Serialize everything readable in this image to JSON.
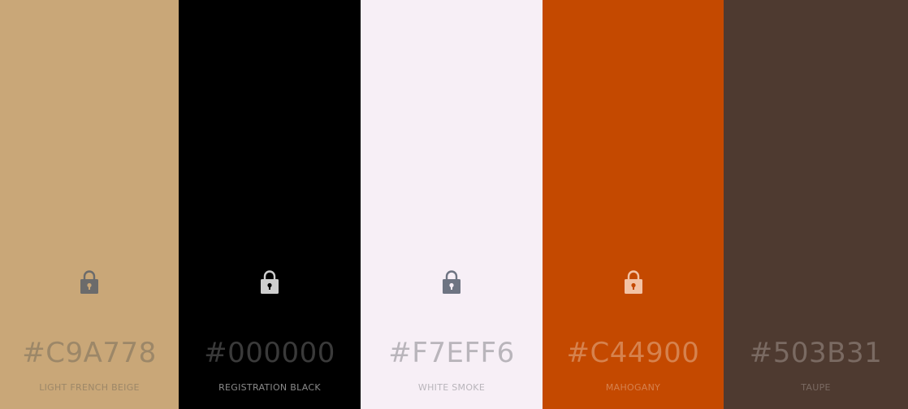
{
  "palette": {
    "swatches": [
      {
        "hex": "#C9A778",
        "name": "LIGHT FRENCH BEIGE",
        "background": "#C9A778",
        "text_color": "#9C8768",
        "lock_color": "#6B6B6B",
        "lock_icon": "lock-icon"
      },
      {
        "hex": "#000000",
        "name": "REGISTRATION BLACK",
        "background": "#000000",
        "text_color": "#3A3A3A",
        "name_color": "#8A8A8A",
        "lock_color": "#CFCFCF",
        "lock_icon": "lock-icon"
      },
      {
        "hex": "#F7EFF6",
        "name": "WHITE SMOKE",
        "background": "#F7EFF6",
        "text_color": "#B9B5BB",
        "lock_color": "#6E7482",
        "lock_icon": "lock-icon"
      },
      {
        "hex": "#C44900",
        "name": "MAHOGANY",
        "background": "#C44900",
        "text_color": "#D6824E",
        "lock_color": "#F3C3A5",
        "lock_icon": "lock-icon"
      },
      {
        "hex": "#503B31",
        "name": "TAUPE",
        "background": "#4E3A30",
        "text_color": "#7A6A62",
        "lock_color": null,
        "lock_icon": null
      }
    ]
  }
}
